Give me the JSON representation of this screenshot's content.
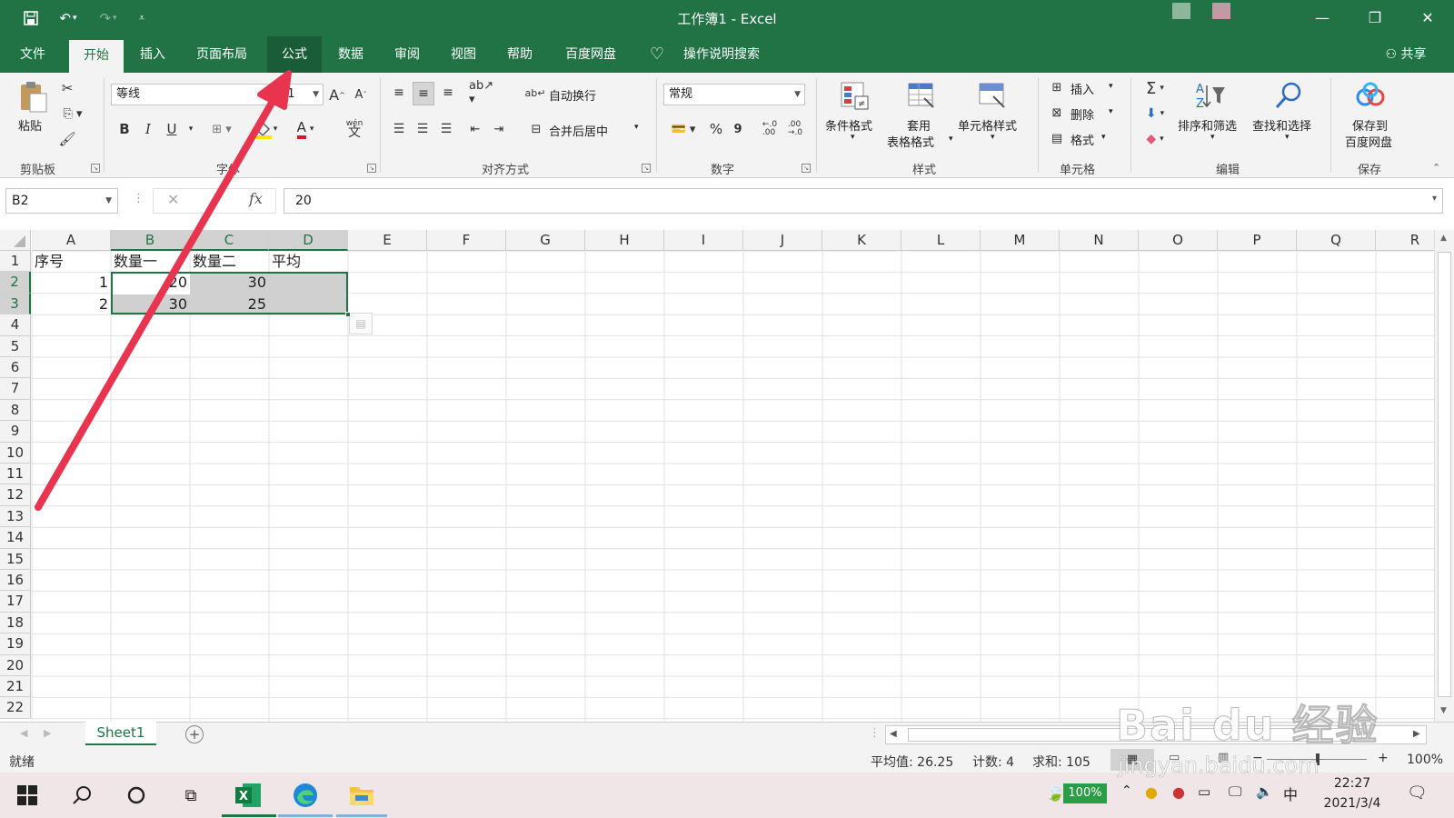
{
  "window": {
    "title": "工作簿1  -  Excel"
  },
  "tabs": [
    "文件",
    "开始",
    "插入",
    "页面布局",
    "公式",
    "数据",
    "审阅",
    "视图",
    "帮助",
    "百度网盘"
  ],
  "active_tab": "开始",
  "tell_me": "操作说明搜索",
  "share": "共享",
  "ribbon": {
    "clipboard": {
      "paste": "粘贴",
      "label": "剪贴板"
    },
    "font": {
      "name": "等线",
      "size": "11",
      "bold": "B",
      "italic": "I",
      "underline": "U",
      "wen": "wén",
      "wen2": "文",
      "grow": "A",
      "shrink": "A",
      "fontcolor": "A",
      "label": "字体"
    },
    "alignment": {
      "wrap": "自动换行",
      "merge": "合并后居中",
      "label": "对齐方式"
    },
    "number": {
      "format": "常规",
      "percent": "%",
      "comma": "9",
      "inc": "←.0 .00",
      "dec": ".00 →.0",
      "label": "数字"
    },
    "styles": {
      "conditional": "条件格式",
      "table1": "套用",
      "table2": "表格格式",
      "cell": "单元格样式",
      "label": "样式"
    },
    "cells": {
      "insert": "插入",
      "delete": "删除",
      "format": "格式",
      "label": "单元格"
    },
    "editing": {
      "sum": "Σ",
      "sort": "排序和筛选",
      "find": "查找和选择",
      "label": "编辑"
    },
    "save": {
      "line1": "保存到",
      "line2": "百度网盘",
      "label": "保存"
    }
  },
  "formula_bar": {
    "name_box": "B2",
    "cancel": "✕",
    "fx": "fx",
    "value": "20"
  },
  "columns": [
    "A",
    "B",
    "C",
    "D",
    "E",
    "F",
    "G",
    "H",
    "I",
    "J",
    "K",
    "L",
    "M",
    "N",
    "O",
    "P",
    "Q",
    "R"
  ],
  "rows": [
    "1",
    "2",
    "3",
    "4",
    "5",
    "6",
    "7",
    "8",
    "9",
    "10",
    "11",
    "12",
    "13",
    "14",
    "15",
    "16",
    "17",
    "18",
    "19",
    "20",
    "21",
    "22"
  ],
  "cells": {
    "A1": "序号",
    "B1": "数量一",
    "C1": "数量二",
    "D1": "平均",
    "A2": "1",
    "B2": "20",
    "C2": "30",
    "A3": "2",
    "B3": "30",
    "C3": "25"
  },
  "sheets": [
    "Sheet1"
  ],
  "status": {
    "ready": "就绪",
    "average": "平均值: 26.25",
    "count": "计数: 4",
    "sum": "求和: 105",
    "zoom": "100%",
    "zoom_minus": "−",
    "zoom_plus": "+"
  },
  "taskbar": {
    "battery": "100%",
    "ime": "中",
    "time": "22:27",
    "date": "2021/3/4"
  },
  "watermark": {
    "text": "Bai du 经验",
    "url": "jingyan.baidu.com"
  },
  "colors": {
    "excel_green": "#217346",
    "arrow": "#e8344e",
    "selection_fill": "#d0d0d0"
  }
}
